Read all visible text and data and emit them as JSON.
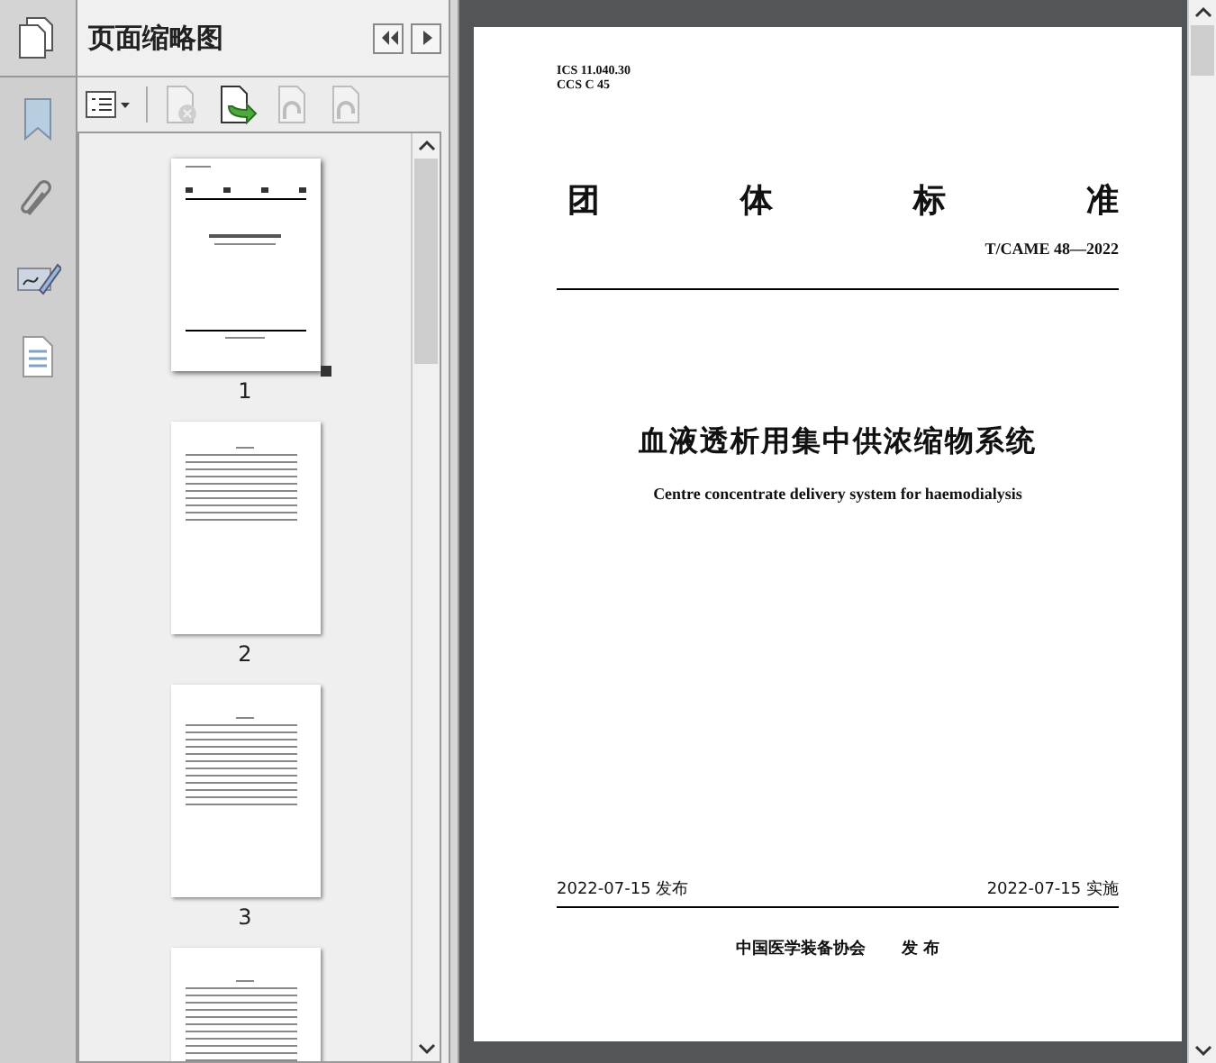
{
  "panel": {
    "title": "页面缩略图"
  },
  "tools": [
    {
      "kind": "options",
      "disabled": false
    },
    {
      "kind": "delete",
      "disabled": true
    },
    {
      "kind": "insert",
      "disabled": false
    },
    {
      "kind": "rotate-left",
      "disabled": true
    },
    {
      "kind": "rotate-right",
      "disabled": true
    }
  ],
  "thumbnails": [
    {
      "kind": "cover",
      "label": "1",
      "selected": true
    },
    {
      "kind": "contents",
      "label": "2",
      "selected": false
    },
    {
      "kind": "text",
      "label": "3",
      "selected": false
    },
    {
      "kind": "text",
      "selected": false
    }
  ],
  "document": {
    "ics": "ICS 11.040.30",
    "ccs": "CCS C 45",
    "heading": [
      "团",
      "体",
      "标",
      "准"
    ],
    "code": "T/CAME 48—2022",
    "title_cn": "血液透析用集中供浓缩物系统",
    "title_en": "Centre concentrate delivery system for haemodialysis",
    "publish_date": "2022-07-15 发布",
    "implement_date": "2022-07-15 实施",
    "publisher": "中国医学装备协会",
    "publisher_action": "发 布"
  }
}
